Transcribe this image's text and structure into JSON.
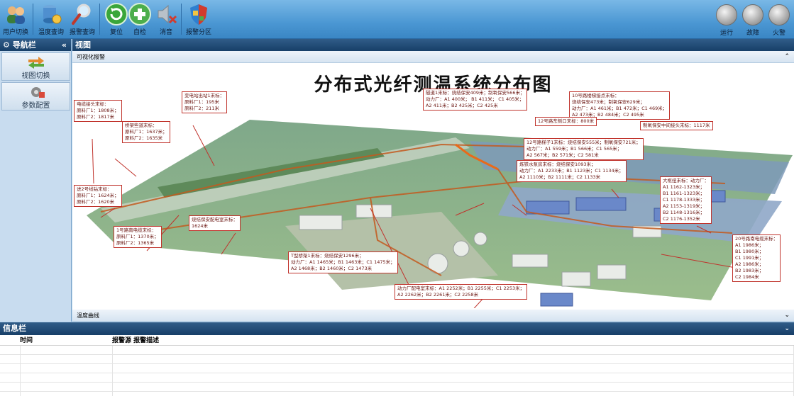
{
  "toolbar": {
    "buttons": [
      {
        "label": "用户切换",
        "icon": "users-icon"
      },
      {
        "label": "温度查询",
        "icon": "database-icon"
      },
      {
        "label": "报警查询",
        "icon": "magnifier-icon"
      },
      {
        "label": "复位",
        "icon": "refresh-icon"
      },
      {
        "label": "自检",
        "icon": "plus-icon"
      },
      {
        "label": "消音",
        "icon": "mute-speaker-icon"
      },
      {
        "label": "报警分区",
        "icon": "shield-icon"
      }
    ],
    "status": [
      {
        "label": "运行"
      },
      {
        "label": "故障"
      },
      {
        "label": "火警"
      }
    ]
  },
  "sidebar": {
    "title": "导航栏",
    "collapse": "«",
    "items": [
      {
        "label": "视图切换",
        "icon": "arrows-switch-icon"
      },
      {
        "label": "参数配置",
        "icon": "gear-icon"
      }
    ]
  },
  "main": {
    "title": "视图",
    "section": "可视化报警",
    "section_toggle": "⌃",
    "footer": "温度曲线",
    "footer_toggle": "⌄"
  },
  "diagram": {
    "title": "分布式光纤测温系统分布图",
    "callouts": [
      {
        "text": "电缆接头末标：\n原料厂1：1808米；\n原料厂2：1817米"
      },
      {
        "text": "变电站出站1末标：\n原料厂1：195米\n原料厂2：211米"
      },
      {
        "text": "桥架些道末标：\n原料厂1：1637米；\n原料厂2：1635米"
      },
      {
        "text": "隧道1末标：烧结保安409米；制氧保安566米；\n动力厂：A1 400米； B1 411米； C1 405米；\nA2 411米；B2 425米；C2 425米"
      },
      {
        "text": "10号路楼梯接点末标：\n烧结保安473米；制氧保安629米；\n动力厂：A1 461米；B1 472米；C1 469米；\nA2 473米；B2 484米；C2 495米"
      },
      {
        "text": "12号路东侧口末标：800米"
      },
      {
        "text": "制氧保安中间接头末标：1117米"
      },
      {
        "text": "12号路梯子1末标：烧结保安555米；制氧保安721米；\n动力厂：A1 559米；B1 566米；C1 565米；\nA2 567米；B2 571米；C2 581米"
      },
      {
        "text": "炼铁水泵房末标：烧结保安1093米；\n动力厂：A1 2233米；B1 1123米；C1 1134米；\nA2 1110米；B2 1111米；C2 1133米"
      },
      {
        "text": "大枢纽末标：动力厂：\nA1 1162-1323米；\nB1 1161-1323米；\nC1 1178-1333米；\nA2 1153-1319米；\nB2 1148-1316米；\nC2 1176-1352米"
      },
      {
        "text": "进2号线钻末标：\n原料厂1：1624米；\n原料厂2：1620米"
      },
      {
        "text": "烧结保安配电室末标：\n1624米"
      },
      {
        "text": "1号路南电缆末标：\n原料厂1：1370米；\n原料厂2：1365米"
      },
      {
        "text": "T型桥架1末标：烧结保安1296米；\n动力厂：A1 1465米；B1 1463米；C1 1475米；\nA2 1468米；B2 1460米；C2 1473米"
      },
      {
        "text": "动力厂配电室末标：A1 2252米；B1 2255米；C1 2253米；\nA2 2262米；B2 2261米；C2 2258米"
      },
      {
        "text": "20号路南电缆末标：\nA1 1986米；\nB1 1980米；\nC1 1991米；\nA2 1986米；\nB2 1983米；\nC2 1984米"
      }
    ]
  },
  "info": {
    "title": "信息栏",
    "toggle": "⌄",
    "columns": [
      "时间",
      "报警源 报警描述"
    ],
    "rows": 6
  }
}
